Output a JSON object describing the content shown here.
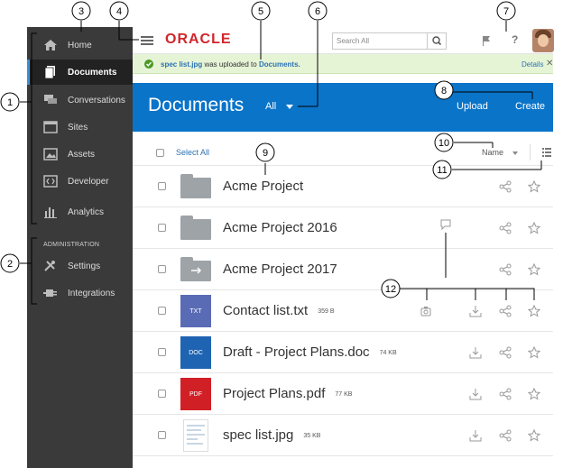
{
  "sidebar": {
    "items": [
      {
        "label": "Home",
        "icon": "home-icon"
      },
      {
        "label": "Documents",
        "icon": "documents-icon",
        "active": true
      },
      {
        "label": "Conversations",
        "icon": "conversations-icon"
      },
      {
        "label": "Sites",
        "icon": "sites-icon"
      },
      {
        "label": "Assets",
        "icon": "assets-icon"
      },
      {
        "label": "Developer",
        "icon": "developer-icon"
      },
      {
        "label": "Analytics",
        "icon": "analytics-icon"
      }
    ],
    "admin_heading": "ADMINISTRATION",
    "admin_items": [
      {
        "label": "Settings",
        "icon": "settings-icon"
      },
      {
        "label": "Integrations",
        "icon": "integrations-icon"
      }
    ]
  },
  "header": {
    "logo": "ORACLE",
    "search_placeholder": "Search All"
  },
  "notification": {
    "file": "spec list.jpg",
    "text": " was uploaded to ",
    "folder": "Documents.",
    "details": "Details",
    "close": "✕"
  },
  "titlebar": {
    "title": "Documents",
    "filter": "All",
    "upload": "Upload",
    "create": "Create"
  },
  "list_toolbar": {
    "select_all": "Select All",
    "sort": "Name"
  },
  "rows": [
    {
      "name": "Acme Project",
      "size": "",
      "type": "folder"
    },
    {
      "name": "Acme Project 2016",
      "size": "",
      "type": "folder"
    },
    {
      "name": "Acme Project 2017",
      "size": "",
      "type": "shared-folder"
    },
    {
      "name": "Contact list.txt",
      "size": "359 B",
      "type": "TXT",
      "badge_color": "#5a6bb5"
    },
    {
      "name": "Draft - Project Plans.doc",
      "size": "74 KB",
      "type": "DOC",
      "badge_color": "#1f64b2"
    },
    {
      "name": "Project Plans.pdf",
      "size": "77 KB",
      "type": "PDF",
      "badge_color": "#d11f26"
    },
    {
      "name": "spec list.jpg",
      "size": "35 KB",
      "type": "image"
    }
  ],
  "callouts": [
    "1",
    "2",
    "3",
    "4",
    "5",
    "6",
    "7",
    "8",
    "9",
    "10",
    "11",
    "12"
  ]
}
